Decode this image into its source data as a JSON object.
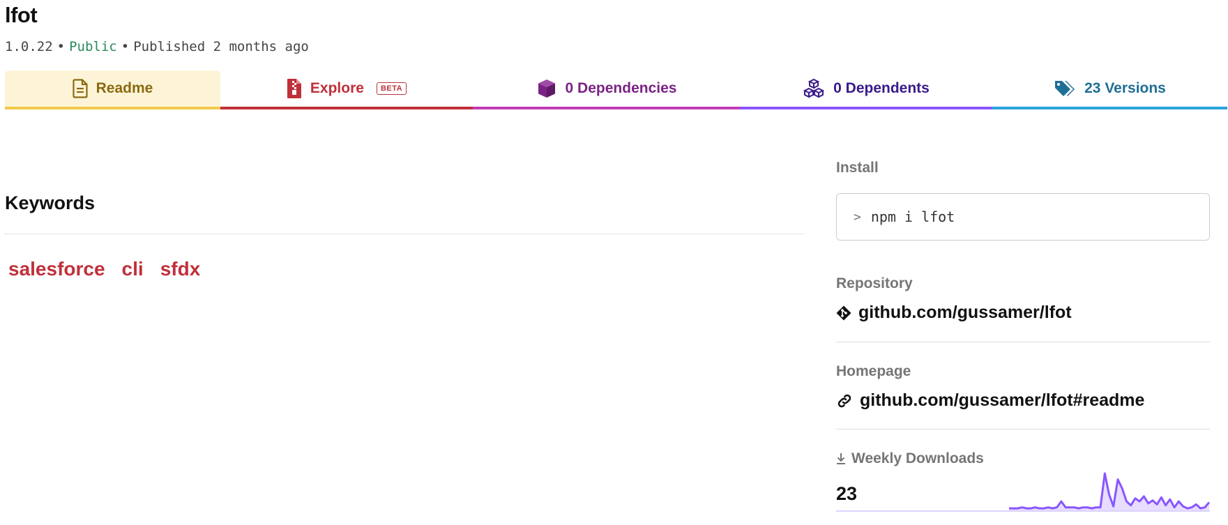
{
  "package": {
    "name": "lfot",
    "version": "1.0.22",
    "visibility": "Public",
    "published": "Published 2 months ago",
    "separator": "•"
  },
  "tabs": {
    "readme": "Readme",
    "explore": "Explore",
    "explore_badge": "BETA",
    "dependencies": "0 Dependencies",
    "dependents": "0 Dependents",
    "versions": "23 Versions"
  },
  "keywords": {
    "heading": "Keywords",
    "items": [
      "salesforce",
      "cli",
      "sfdx"
    ]
  },
  "sidebar": {
    "install_label": "Install",
    "install_prompt": ">",
    "install_command": "npm i lfot",
    "repository_label": "Repository",
    "repository_url": "github.com/gussamer/lfot",
    "homepage_label": "Homepage",
    "homepage_url": "github.com/gussamer/lfot#readme",
    "weekly_downloads_label": "Weekly Downloads",
    "weekly_downloads_count": "23"
  },
  "colors": {
    "readme": "#8a6a10",
    "explore": "#c0303a",
    "dependencies": "#7a2384",
    "dependents": "#3a1a8a",
    "versions": "#1f6e95",
    "public": "#2a8a5a",
    "sparkline": "#8956ff"
  },
  "icons": {
    "readme": "document-icon",
    "explore": "zip-file-icon",
    "dependencies": "box-icon",
    "dependents": "boxes-icon",
    "versions": "tags-icon",
    "repository": "git-icon",
    "homepage": "link-icon",
    "downloads": "download-icon"
  },
  "chart_data": {
    "type": "area",
    "values": [
      2,
      2,
      2,
      3,
      2,
      2,
      3,
      2,
      2,
      3,
      2,
      3,
      9,
      3,
      3,
      3,
      2,
      3,
      3,
      2,
      3,
      3,
      37,
      16,
      4,
      31,
      22,
      9,
      5,
      12,
      9,
      14,
      7,
      10,
      6,
      13,
      5,
      11,
      3,
      9,
      4,
      2,
      3,
      6,
      2,
      3,
      8
    ]
  }
}
